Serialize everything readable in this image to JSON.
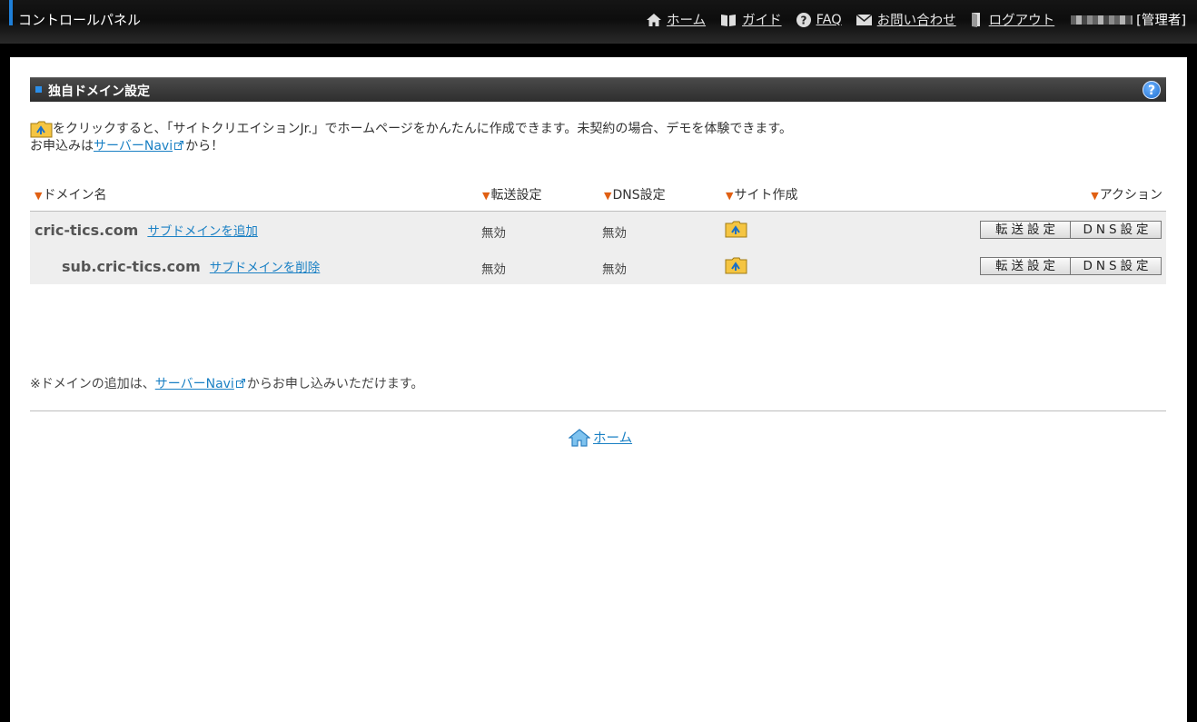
{
  "header": {
    "title": "コントロールパネル",
    "nav": [
      {
        "icon": "home-icon",
        "label": "ホーム"
      },
      {
        "icon": "book-icon",
        "label": "ガイド"
      },
      {
        "icon": "question-circle-icon",
        "label": "FAQ"
      },
      {
        "icon": "mail-icon",
        "label": "お問い合わせ"
      },
      {
        "icon": "door-exit-icon",
        "label": "ログアウト"
      }
    ],
    "user_role": "[管理者]"
  },
  "section": {
    "title": "独自ドメイン設定",
    "help_label": "?"
  },
  "intro": {
    "line1": "をクリックすると、「サイトクリエイションJr.」でホームページをかんたんに作成できます。未契約の場合、デモを体験できます。",
    "line2_prefix": "お申込みは",
    "line2_link": "サーバーNavi",
    "line2_suffix": "から！"
  },
  "table": {
    "columns": [
      "ドメイン名",
      "転送設定",
      "DNS設定",
      "サイト作成",
      "アクション"
    ],
    "rows": [
      {
        "domain": "cric-tics.com",
        "sub_link": "サブドメインを追加",
        "forward": "無効",
        "dns": "無効",
        "btn_forward": "転送設定",
        "btn_dns": "DNS設定"
      },
      {
        "domain": "sub.cric-tics.com",
        "sub_link": "サブドメインを削除",
        "forward": "無効",
        "dns": "無効",
        "btn_forward": "転送設定",
        "btn_dns": "DNS設定"
      }
    ]
  },
  "note": {
    "prefix": "※ドメインの追加は、",
    "link": "サーバーNavi",
    "suffix": "からお申し込みいただけます。"
  },
  "footer": {
    "home_label": "ホーム"
  },
  "colors": {
    "accent": "#1e7fd8",
    "link": "#1a80c4",
    "triangle": "#e05f12"
  }
}
